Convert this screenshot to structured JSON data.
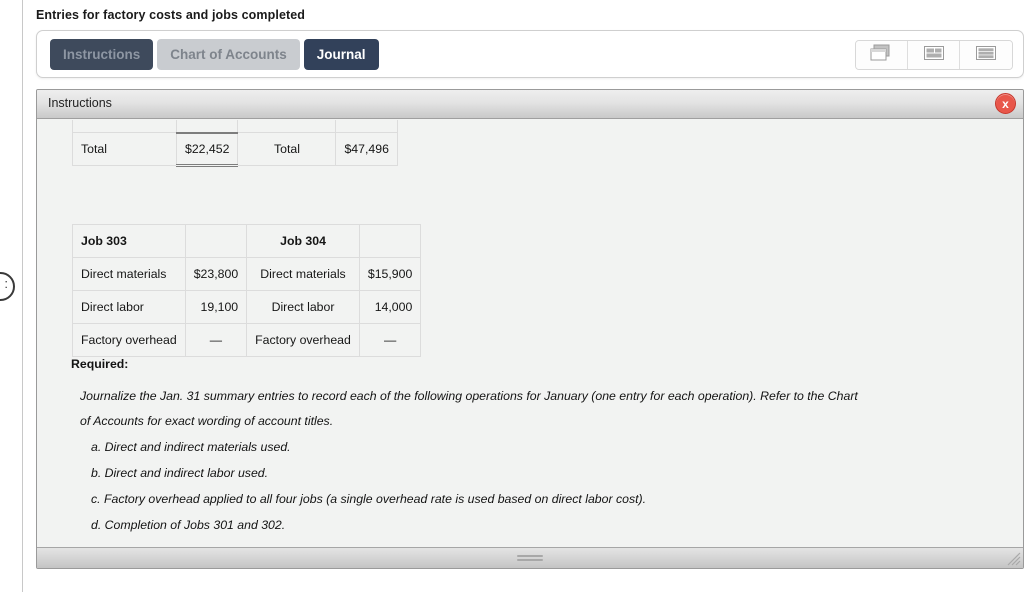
{
  "page": {
    "title": "Entries for factory costs and jobs completed"
  },
  "toolbar": {
    "tabs": [
      {
        "label": "Instructions",
        "state": "dark-muted"
      },
      {
        "label": "Chart of Accounts",
        "state": "light"
      },
      {
        "label": "Journal",
        "state": "dark-on"
      }
    ],
    "view_buttons": [
      {
        "icon": "cascade-windows-icon",
        "title": "Cascade"
      },
      {
        "icon": "tile-grid-icon",
        "title": "Tile"
      },
      {
        "icon": "stacked-rows-icon",
        "title": "Stack"
      }
    ]
  },
  "window": {
    "title": "Instructions",
    "close_label": "x",
    "close_icon": "close-icon"
  },
  "table_top": {
    "rows": [
      {
        "label": "",
        "value": "",
        "label2": "",
        "value2": "",
        "clipped": true
      },
      {
        "label": "Total",
        "value": "$22,452",
        "label2": "Total",
        "value2": "$47,496",
        "clipped": false
      }
    ]
  },
  "table_jobs": {
    "header": {
      "left": "Job 303",
      "right": "Job 304"
    },
    "rows": [
      {
        "label": "Direct materials",
        "value": "$23,800",
        "label2": "Direct materials",
        "value2": "$15,900"
      },
      {
        "label": "Direct labor",
        "value": "19,100",
        "label2": "Direct labor",
        "value2": "14,000"
      },
      {
        "label": "Factory overhead",
        "value": "—",
        "label2": "Factory overhead",
        "value2": "—"
      }
    ]
  },
  "required": {
    "heading": "Required:",
    "paragraph": "Journalize the Jan. 31 summary entries to record each of the following operations for January (one entry for each operation). Refer to the Chart of Accounts for exact wording of account titles.",
    "items": [
      "a. Direct and indirect materials used.",
      "b. Direct and indirect labor used.",
      "c. Factory overhead applied to all four jobs (a single overhead rate is used based on direct labor cost).",
      "d. Completion of Jobs 301 and 302."
    ]
  },
  "edge_knob": {
    "glyph": ":"
  },
  "colors": {
    "tab_active": "#32415a",
    "tab_inactive_dark": "#3e4a5c",
    "tab_light": "#c9ccd0",
    "close_red": "#e8564a",
    "panel_bg": "#f2f3f2"
  }
}
